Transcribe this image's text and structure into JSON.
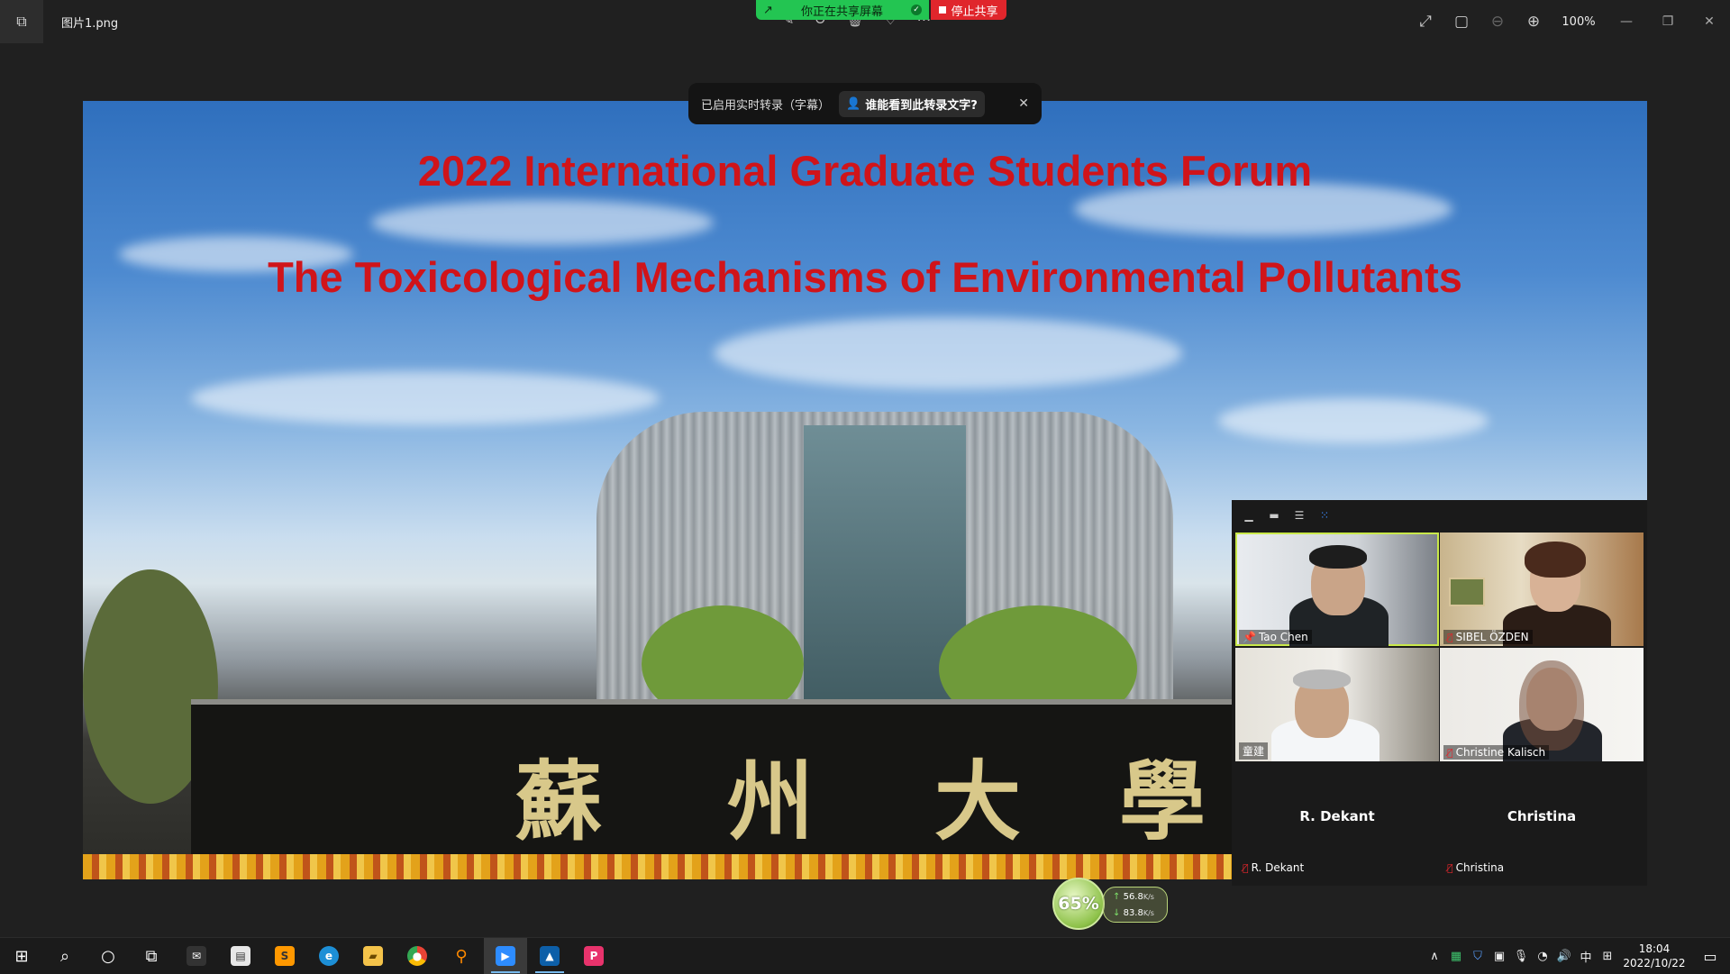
{
  "window": {
    "file_name": "图片1.png",
    "zoom_level": "100%"
  },
  "share_banner": {
    "sharing_text": "你正在共享屏幕",
    "stop_label": "停止共享"
  },
  "caption_toast": {
    "status_text": "已启用实时转录（字幕）",
    "who_can_see": "谁能看到此转录文字?"
  },
  "slide": {
    "title_line_1": "2022 International Graduate Students Forum",
    "title_line_2": "The Toxicological Mechanisms of Environmental Pollutants",
    "sign_characters": [
      "蘇",
      "州",
      "大",
      "學"
    ]
  },
  "gallery": {
    "participants": [
      {
        "name": "Tao Chen",
        "muted": false,
        "speaking": true,
        "video": true
      },
      {
        "name": "SIBEL ÖZDEN",
        "muted": true,
        "speaking": false,
        "video": true
      },
      {
        "name": "童建",
        "muted": false,
        "speaking": false,
        "video": true
      },
      {
        "name": "Christine Kalisch",
        "muted": true,
        "speaking": false,
        "video": true
      },
      {
        "name": "R. Dekant",
        "muted": true,
        "speaking": false,
        "video": false
      },
      {
        "name": "Christina",
        "muted": true,
        "speaking": false,
        "video": false
      }
    ]
  },
  "net_widget": {
    "percent": "65%",
    "up_speed": "56.8",
    "up_unit": "K/s",
    "down_speed": "83.8",
    "down_unit": "K/s"
  },
  "taskbar": {
    "time": "18:04",
    "date": "2022/10/22",
    "ime": "中"
  }
}
